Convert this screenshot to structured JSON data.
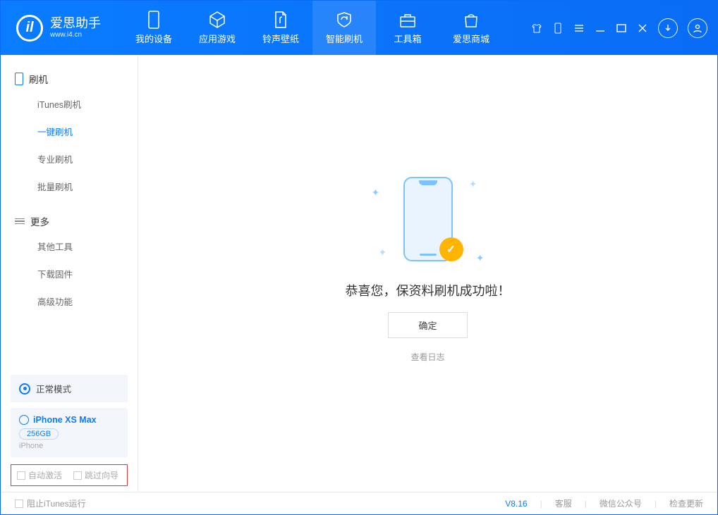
{
  "brand": {
    "title": "爱思助手",
    "subtitle": "www.i4.cn",
    "logo_letter": "il"
  },
  "nav": [
    {
      "label": "我的设备"
    },
    {
      "label": "应用游戏"
    },
    {
      "label": "铃声壁纸"
    },
    {
      "label": "智能刷机"
    },
    {
      "label": "工具箱"
    },
    {
      "label": "爱思商城"
    }
  ],
  "sidebar": {
    "group1_title": "刷机",
    "group1_items": [
      "iTunes刷机",
      "一键刷机",
      "专业刷机",
      "批量刷机"
    ],
    "group2_title": "更多",
    "group2_items": [
      "其他工具",
      "下载固件",
      "高级功能"
    ],
    "mode_card": "正常模式",
    "device": {
      "name": "iPhone XS Max",
      "storage": "256GB",
      "sub": "iPhone"
    },
    "checks": [
      "自动激活",
      "跳过向导"
    ]
  },
  "main": {
    "success_title": "恭喜您，保资料刷机成功啦！",
    "confirm": "确定",
    "view_log": "查看日志"
  },
  "statusbar": {
    "block_itunes": "阻止iTunes运行",
    "version": "V8.16",
    "links": [
      "客服",
      "微信公众号",
      "检查更新"
    ]
  }
}
